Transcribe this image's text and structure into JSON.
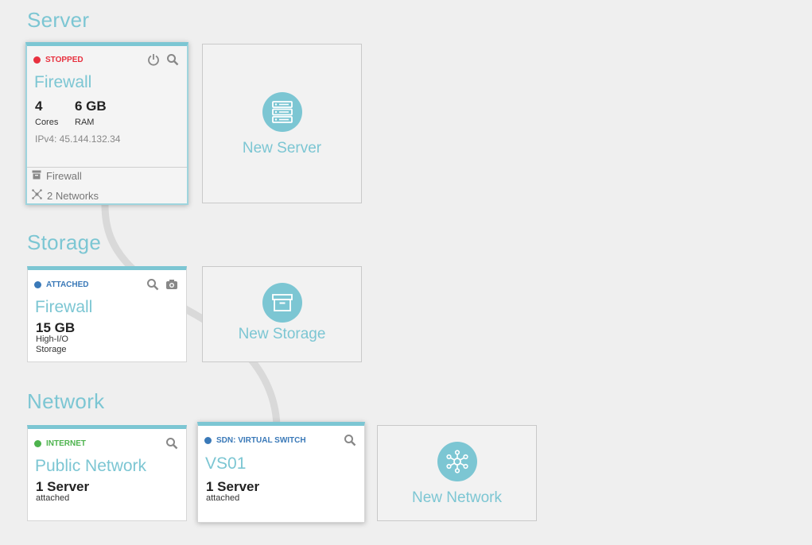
{
  "sections": {
    "server": "Server",
    "storage": "Storage",
    "network": "Network"
  },
  "server_card": {
    "status": "STOPPED",
    "status_color": "#e8313f",
    "name": "Firewall",
    "cores_value": "4",
    "cores_label": "Cores",
    "ram_value": "6 GB",
    "ram_label": "RAM",
    "ipv4": "IPv4: 45.144.132.34",
    "footer_storage": "Firewall",
    "footer_networks": "2 Networks"
  },
  "new_server": {
    "label": "New Server",
    "icon": "server-stack-icon"
  },
  "storage_card": {
    "status": "ATTACHED",
    "status_color": "#3a79b8",
    "name": "Firewall",
    "size": "15 GB",
    "type_line1": "High-I/O",
    "type_line2": "Storage"
  },
  "new_storage": {
    "label": "New Storage",
    "icon": "archive-box-icon"
  },
  "network_cards": [
    {
      "status": "INTERNET",
      "status_color": "#4db34d",
      "name": "Public Network",
      "count": "1 Server",
      "sub": "attached"
    },
    {
      "status": "SDN: VIRTUAL SWITCH",
      "status_color": "#3a79b8",
      "name": "VS01",
      "count": "1 Server",
      "sub": "attached"
    }
  ],
  "new_network": {
    "label": "New Network",
    "icon": "network-hub-icon"
  },
  "colors": {
    "accent": "#7cc6d3",
    "background": "#efefef",
    "connector": "#d9d9d9"
  }
}
